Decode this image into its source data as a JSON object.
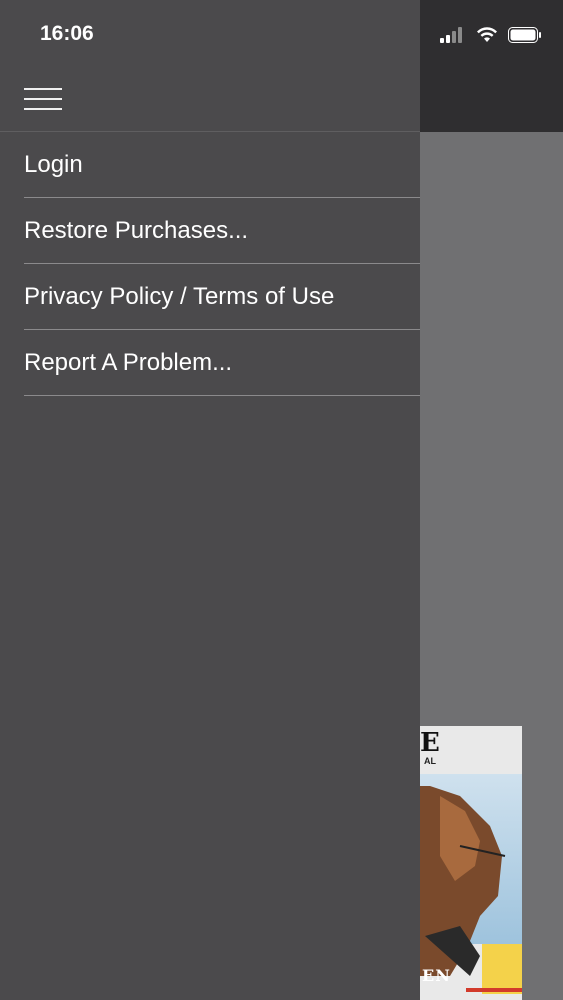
{
  "status_bar": {
    "time": "16:06"
  },
  "drawer": {
    "menu_items": [
      {
        "label": "Login"
      },
      {
        "label": "Restore Purchases..."
      },
      {
        "label": "Privacy Policy / Terms of Use"
      },
      {
        "label": "Report A Problem..."
      }
    ]
  },
  "cover": {
    "title_fragment": "E",
    "subtitle_fragment": "AL",
    "bottom_fragment": "EN"
  },
  "colors": {
    "drawer_bg": "#4b4a4c",
    "background_dim": "#707072",
    "topbar_bg": "#2f2e30",
    "divider": "#8b8a8c",
    "text": "#ffffff"
  },
  "icons": [
    "hamburger-menu-icon",
    "cellular-signal-icon",
    "wifi-icon",
    "battery-icon"
  ]
}
